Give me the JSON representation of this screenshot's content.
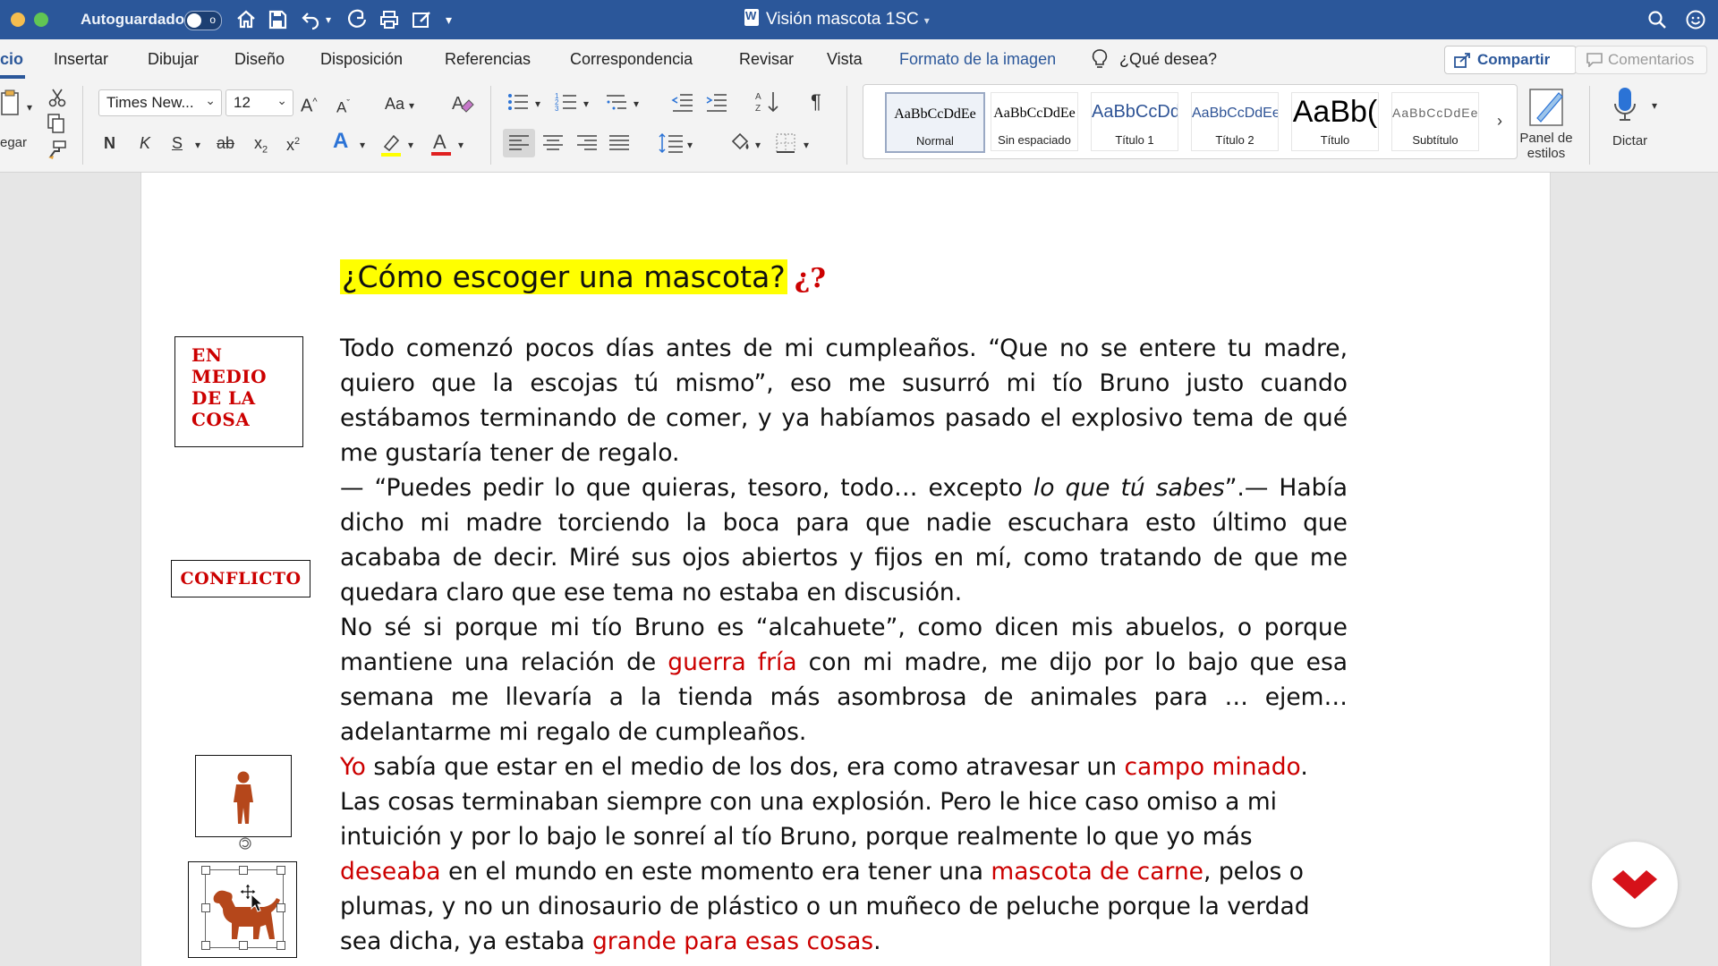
{
  "titlebar": {
    "autosave_label": "Autoguardado",
    "autosave_state": "o",
    "document_title": "Visión mascota 1SC",
    "colors": {
      "bar": "#2b579a"
    }
  },
  "tabs": [
    {
      "label": "cio",
      "active": true
    },
    {
      "label": "Insertar"
    },
    {
      "label": "Dibujar"
    },
    {
      "label": "Diseño"
    },
    {
      "label": "Disposición"
    },
    {
      "label": "Referencias"
    },
    {
      "label": "Correspondencia"
    },
    {
      "label": "Revisar"
    },
    {
      "label": "Vista"
    },
    {
      "label": "Formato de la imagen"
    },
    {
      "label": "¿Qué desea?"
    }
  ],
  "share_label": "Compartir",
  "comments_label": "Comentarios",
  "ribbon": {
    "paste_label": "egar",
    "font_name": "Times New...",
    "font_size": "12",
    "change_case": "Aa",
    "bold": "N",
    "italic": "K",
    "underline": "S",
    "strike": "ab",
    "subscript": "x",
    "superscript": "x",
    "styles": [
      {
        "preview": "AaBbCcDdEe",
        "name": "Normal",
        "selected": true
      },
      {
        "preview": "AaBbCcDdEe",
        "name": "Sin espaciado"
      },
      {
        "preview": "AaBbCcDd",
        "name": "Título 1"
      },
      {
        "preview": "AaBbCcDdEe",
        "name": "Título 2"
      },
      {
        "preview": "AaBb(",
        "name": "Título"
      },
      {
        "preview": "AaBbCcDdEe",
        "name": "Subtítulo"
      }
    ],
    "styles_pane_label_1": "Panel de",
    "styles_pane_label_2": "estilos",
    "dictate_label": "Dictar"
  },
  "document": {
    "heading": "¿Cómo escoger una mascota?",
    "heading_marks": "¿?",
    "side_labels": {
      "en_medio": [
        "EN",
        "MEDIO",
        "DE LA",
        "COSA"
      ],
      "conflicto": "CONFLICTO"
    },
    "p1": "Todo comenzó pocos días antes de mi cumpleaños. “Que no se entere tu madre, quiero que la escojas tú mismo”, eso me susurró mi tío Bruno justo cuando estábamos terminando de comer, y ya habíamos pasado el explosivo tema de qué me gustaría tener de regalo.",
    "p2_a": " — “Puedes pedir lo que quieras, tesoro, todo…  excepto ",
    "p2_italic": "lo que tú sabes",
    "p2_b": "”.—  Había dicho mi madre torciendo la boca para que nadie escuchara esto último que acababa de decir. Miré sus ojos abiertos y fijos en mí, como tratando de que me quedara claro que ese tema no estaba en discusión.",
    "p3_a": "No sé si porque mi tío Bruno es “alcahuete”, como dicen mis abuelos, o porque mantiene una relación de ",
    "p3_red": "guerra fría",
    "p3_b": " con mi madre, me dijo por lo bajo que esa semana me llevaría a la tienda más asombrosa de animales para … ejem… adelantarme mi regalo de cumpleaños.",
    "p4_red1": "Yo",
    "p4_a": " sabía que estar en el medio de los dos, era como atravesar un ",
    "p4_red2": "campo minado",
    "p4_b": ".  Las cosas terminaban siempre con una explosión. Pero le hice caso omiso a mi intuición y por lo bajo le sonreí al tío Bruno, porque realmente lo que yo más ",
    "p4_red3": "deseaba",
    "p4_c": " en el mundo en este momento era tener una ",
    "p4_red4": "mascota de carne",
    "p4_d": ", pelos o plumas, y no un dinosaurio de plástico o un muñeco de peluche porque la verdad sea dicha, ya estaba ",
    "p4_red5": "grande para esas cosas",
    "p4_e": ".",
    "colors": {
      "highlight": "#ffff00",
      "emphasis": "#c00000",
      "figure": "#b5471b"
    }
  },
  "icons": [
    "home-icon",
    "save-icon",
    "undo-icon",
    "redo-icon",
    "print-icon",
    "edit-icon",
    "search-icon",
    "smiley-icon",
    "lightbulb-icon",
    "share-icon",
    "comment-icon",
    "cut-icon",
    "copy-icon",
    "format-painter-icon",
    "microphone-icon",
    "brand-logo"
  ]
}
